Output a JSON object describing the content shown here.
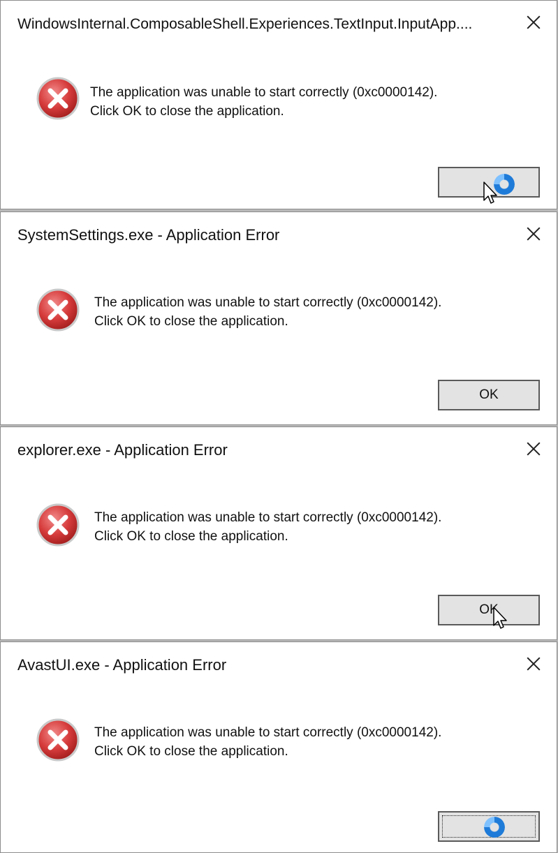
{
  "colors": {
    "error_red": "#d63b3b",
    "button_face": "#e3e3e3",
    "busy_blue": "#1f7bd8"
  },
  "dialogs": [
    {
      "title": "WindowsInternal.ComposableShell.Experiences.TextInput.InputApp....",
      "message_line1": "The application was unable to start correctly (0xc0000142).",
      "message_line2": "Click OK to close the application.",
      "ok_label": "",
      "icon": "error-icon",
      "cursor": "busy-cursor"
    },
    {
      "title": "SystemSettings.exe - Application Error",
      "message_line1": "The application was unable to start correctly (0xc0000142).",
      "message_line2": "Click OK to close the application.",
      "ok_label": "OK",
      "icon": "error-icon"
    },
    {
      "title": "explorer.exe - Application Error",
      "message_line1": "The application was unable to start correctly (0xc0000142).",
      "message_line2": "Click OK to close the application.",
      "ok_label": "OK",
      "icon": "error-icon",
      "cursor": "arrow-cursor"
    },
    {
      "title": "AvastUI.exe - Application Error",
      "message_line1": "The application was unable to start correctly (0xc0000142).",
      "message_line2": "Click OK to close the application.",
      "ok_label": "",
      "icon": "error-icon",
      "cursor": "busy-cursor"
    }
  ]
}
